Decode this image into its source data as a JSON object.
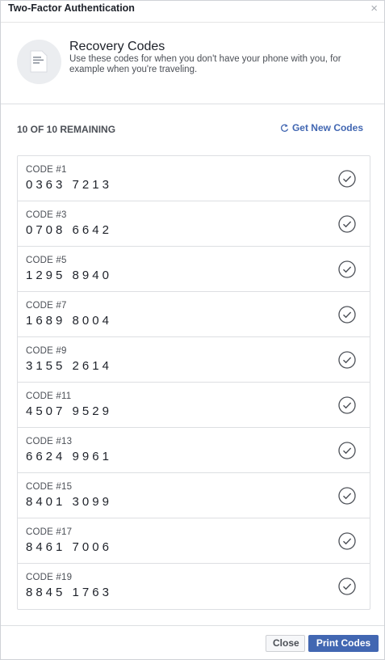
{
  "dialog": {
    "title": "Two-Factor Authentication",
    "close_icon": "close-icon"
  },
  "intro": {
    "icon": "document-icon",
    "title": "Recovery Codes",
    "description": "Use these codes for when you don't have your phone with you, for example when you're traveling."
  },
  "status": {
    "remaining": "10 OF 10 REMAINING",
    "get_new_label": "Get New Codes",
    "get_new_icon": "refresh-icon"
  },
  "codes": [
    {
      "label": "CODE #1",
      "value": "0363 7213"
    },
    {
      "label": "CODE #3",
      "value": "0708 6642"
    },
    {
      "label": "CODE #5",
      "value": "1295 8940"
    },
    {
      "label": "CODE #7",
      "value": "1689 8004"
    },
    {
      "label": "CODE #9",
      "value": "3155 2614"
    },
    {
      "label": "CODE #11",
      "value": "4507 9529"
    },
    {
      "label": "CODE #13",
      "value": "6624 9961"
    },
    {
      "label": "CODE #15",
      "value": "8401 3099"
    },
    {
      "label": "CODE #17",
      "value": "8461 7006"
    },
    {
      "label": "CODE #19",
      "value": "8845 1763"
    }
  ],
  "footer": {
    "close_label": "Close",
    "print_label": "Print Codes"
  },
  "colors": {
    "accent": "#4267b2",
    "text": "#1d2129",
    "muted": "#4b4f56",
    "border": "#dddfe2"
  }
}
